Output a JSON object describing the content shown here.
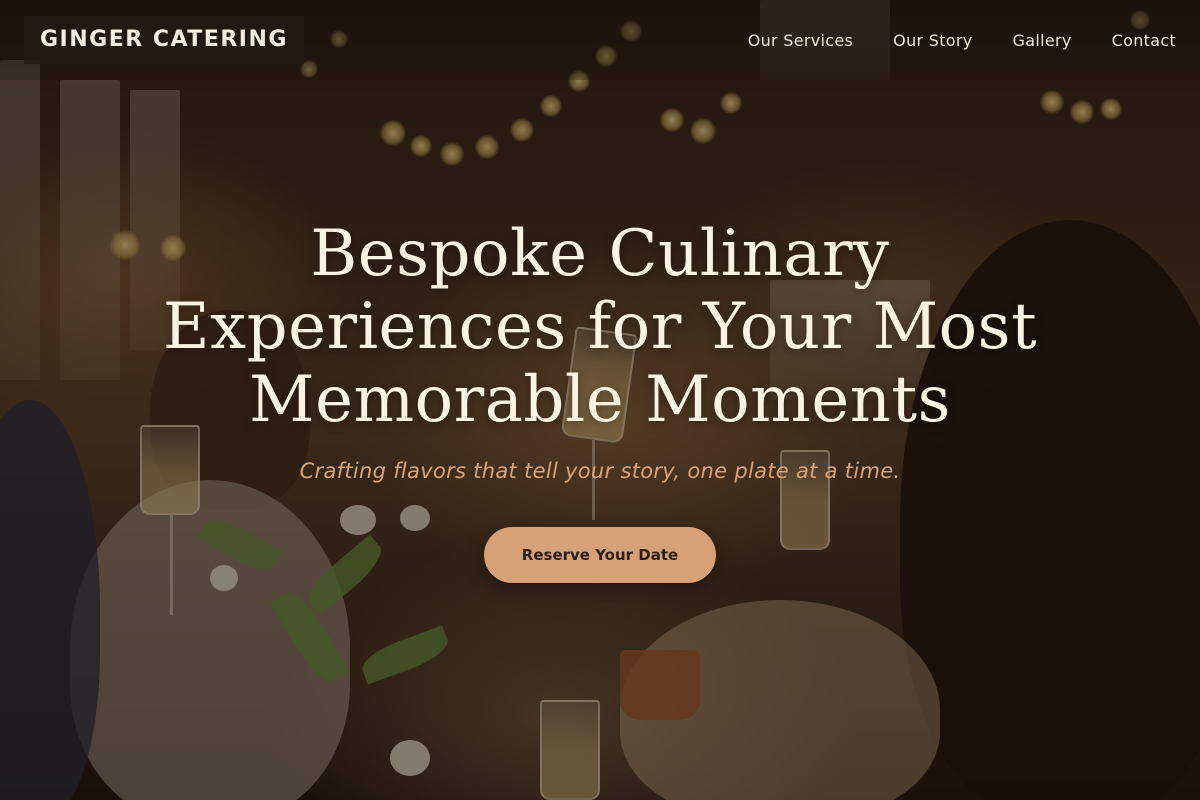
{
  "brand": {
    "name": "GINGER CATERING"
  },
  "nav": {
    "items": [
      {
        "label": "Our Services"
      },
      {
        "label": "Our Story"
      },
      {
        "label": "Gallery"
      },
      {
        "label": "Contact"
      }
    ]
  },
  "hero": {
    "headline": "Bespoke Culinary Experiences for Your Most Memorable Moments",
    "tagline": "Crafting flavors that tell your story, one plate at a time.",
    "cta_label": "Reserve Your Date",
    "background_image": "celebration-toast-photo"
  },
  "colors": {
    "accent": "#d7a178",
    "tagline": "#d6a57a",
    "headline": "#fbf3e1",
    "logo_bg": "#231a14"
  }
}
